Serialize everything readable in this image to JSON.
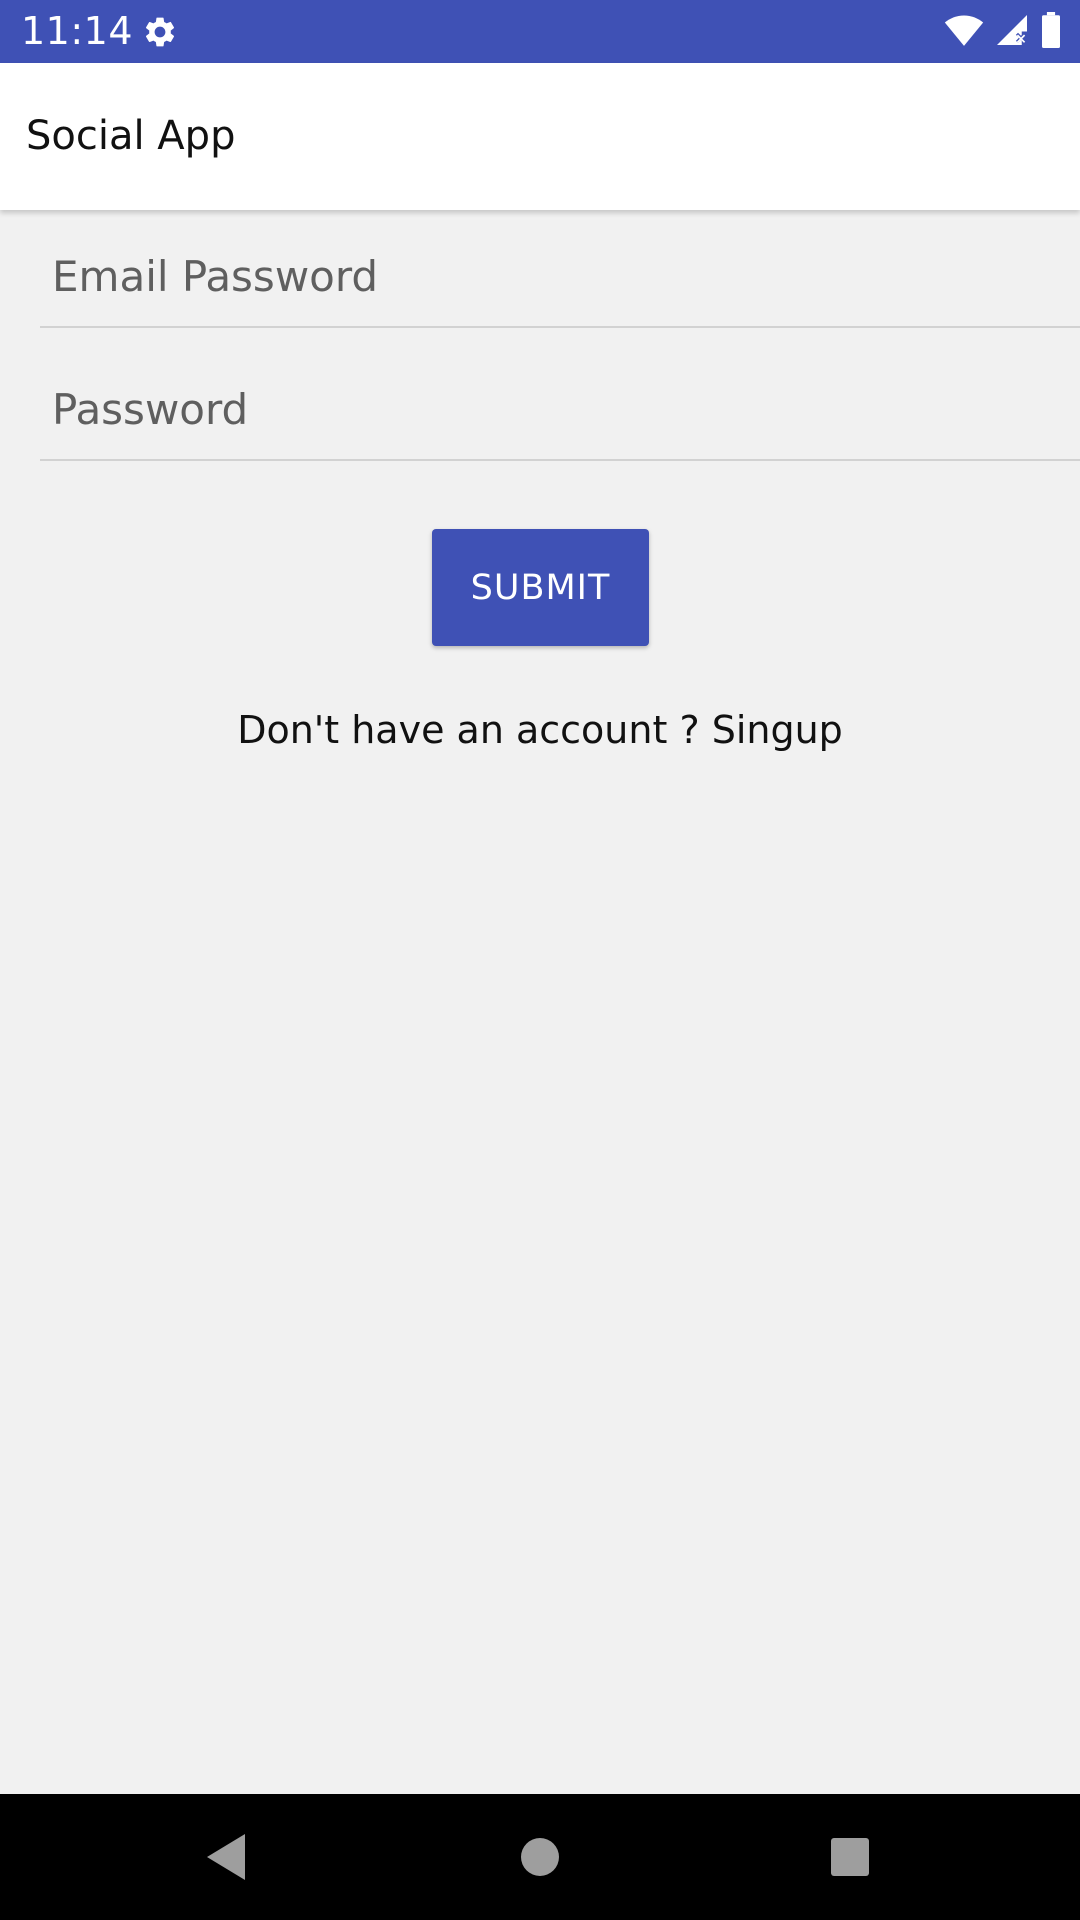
{
  "status_bar": {
    "time": "11:14",
    "icons": [
      "gear-icon",
      "wifi-icon",
      "signal-icon",
      "battery-icon"
    ],
    "color": "#3f51b5"
  },
  "app_bar": {
    "title": "Social App"
  },
  "form": {
    "email": {
      "placeholder": "Email Password",
      "value": ""
    },
    "password": {
      "placeholder": "Password",
      "value": ""
    },
    "submit_label": "SUBMIT",
    "signup_text": "Don't have an account ? Singup"
  },
  "nav_bar": {
    "icons": [
      "back-icon",
      "home-icon",
      "recents-icon"
    ]
  },
  "colors": {
    "primary": "#3f51b5",
    "background": "#f1f1f1",
    "appbar": "#ffffff",
    "navbar": "#000000"
  }
}
